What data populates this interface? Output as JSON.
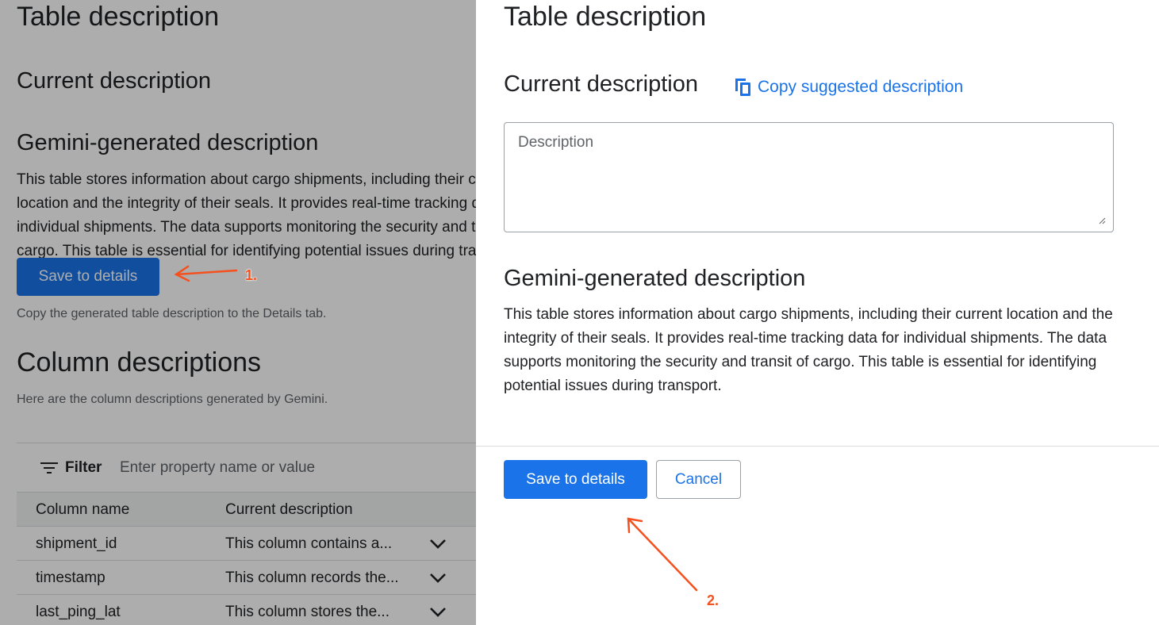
{
  "background_page": {
    "title": "Table description",
    "current_description_heading": "Current description",
    "gemini_heading": "Gemini-generated description",
    "gemini_text": "This table stores information about cargo shipments, including their current location and the integrity of their seals. It provides real-time tracking data for individual shipments. The data supports monitoring the security and transit of cargo. This table is essential for identifying potential issues during transport.",
    "save_button": "Save to details",
    "save_hint": "Copy the generated table description to the Details tab.",
    "column_descriptions_heading": "Column descriptions",
    "column_descriptions_sub": "Here are the column descriptions generated by Gemini.",
    "filter": {
      "label": "Filter",
      "placeholder": "Enter property name or value",
      "icon": "filter-list-icon"
    },
    "table": {
      "headers": [
        "Column name",
        "Current description"
      ],
      "rows": [
        {
          "name": "shipment_id",
          "desc": "This column contains a..."
        },
        {
          "name": "timestamp",
          "desc": "This column records the..."
        },
        {
          "name": "last_ping_lat",
          "desc": "This column stores the..."
        }
      ],
      "row_icon": "chevron-down-icon"
    }
  },
  "panel": {
    "title": "Table description",
    "current_description_heading": "Current description",
    "copy_link": "Copy suggested description",
    "copy_icon": "content-copy-icon",
    "description_placeholder": "Description",
    "gemini_heading": "Gemini-generated description",
    "gemini_text": "This table stores information about cargo shipments, including their current location and the integrity of their seals. It provides real-time tracking data for individual shipments. The data supports monitoring the security and transit of cargo. This table is essential for identifying potential issues during transport.",
    "save_button": "Save to details",
    "cancel_button": "Cancel"
  },
  "annotations": {
    "step1": "1.",
    "step2": "2.",
    "arrow_color": "#f4511e"
  },
  "colors": {
    "accent": "#1a73e8",
    "scrim": "rgba(0,0,0,0.32)"
  }
}
